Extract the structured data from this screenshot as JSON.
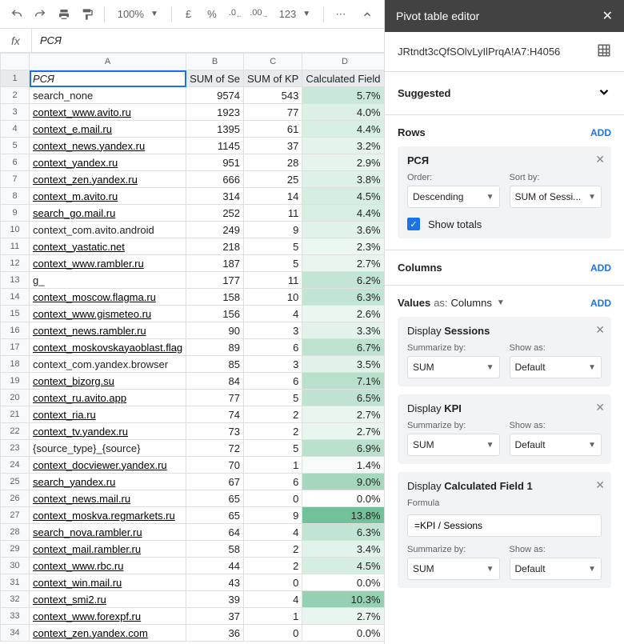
{
  "toolbar": {
    "zoom": "100%",
    "currency": "£",
    "percent": "%",
    "dec_dec": ".0",
    "dec_inc": ".00",
    "format": "123"
  },
  "formula": {
    "fx": "fx",
    "value": "РСЯ"
  },
  "columns": [
    "A",
    "B",
    "C",
    "D",
    ""
  ],
  "header_row": {
    "a": "РСЯ",
    "b": "SUM of Se",
    "c": "SUM of KP",
    "d": "Calculated Field"
  },
  "rows": [
    {
      "n": 2,
      "a": "search_none",
      "link": false,
      "b": 9574,
      "c": 543,
      "d": "5.7%",
      "bg": "#c9e8d9"
    },
    {
      "n": 3,
      "a": "context_www.avito.ru",
      "link": true,
      "b": 1923,
      "c": 77,
      "d": "4.0%",
      "bg": "#dcf0e6"
    },
    {
      "n": 4,
      "a": "context_e.mail.ru",
      "link": true,
      "b": 1395,
      "c": 61,
      "d": "4.4%",
      "bg": "#d7eee2"
    },
    {
      "n": 5,
      "a": "context_news.yandex.ru",
      "link": true,
      "b": 1145,
      "c": 37,
      "d": "3.2%",
      "bg": "#e4f3ec"
    },
    {
      "n": 6,
      "a": "context_yandex.ru",
      "link": true,
      "b": 951,
      "c": 28,
      "d": "2.9%",
      "bg": "#e7f4ee"
    },
    {
      "n": 7,
      "a": "context_zen.yandex.ru",
      "link": true,
      "b": 666,
      "c": 25,
      "d": "3.8%",
      "bg": "#def1e8"
    },
    {
      "n": 8,
      "a": "context_m.avito.ru",
      "link": true,
      "b": 314,
      "c": 14,
      "d": "4.5%",
      "bg": "#d6ede1"
    },
    {
      "n": 9,
      "a": "search_go.mail.ru",
      "link": true,
      "b": 252,
      "c": 11,
      "d": "4.4%",
      "bg": "#d7eee2"
    },
    {
      "n": 10,
      "a": "context_com.avito.android",
      "link": false,
      "b": 249,
      "c": 9,
      "d": "3.6%",
      "bg": "#e0f2ea"
    },
    {
      "n": 11,
      "a": "context_yastatic.net",
      "link": true,
      "b": 218,
      "c": 5,
      "d": "2.3%",
      "bg": "#edf7f2"
    },
    {
      "n": 12,
      "a": "context_www.rambler.ru",
      "link": true,
      "b": 187,
      "c": 5,
      "d": "2.7%",
      "bg": "#e9f5ef"
    },
    {
      "n": 13,
      "a": "g_",
      "link": false,
      "b": 177,
      "c": 11,
      "d": "6.2%",
      "bg": "#c3e5d4"
    },
    {
      "n": 14,
      "a": "context_moscow.flagma.ru",
      "link": true,
      "b": 158,
      "c": 10,
      "d": "6.3%",
      "bg": "#c2e4d3"
    },
    {
      "n": 15,
      "a": "context_www.gismeteo.ru",
      "link": true,
      "b": 156,
      "c": 4,
      "d": "2.6%",
      "bg": "#eaf6f0"
    },
    {
      "n": 16,
      "a": "context_news.rambler.ru",
      "link": true,
      "b": 90,
      "c": 3,
      "d": "3.3%",
      "bg": "#e3f3eb"
    },
    {
      "n": 17,
      "a": "context_moskovskayaoblast.flag",
      "link": true,
      "b": 89,
      "c": 6,
      "d": "6.7%",
      "bg": "#bde2cf"
    },
    {
      "n": 18,
      "a": "context_com.yandex.browser",
      "link": false,
      "b": 85,
      "c": 3,
      "d": "3.5%",
      "bg": "#e1f2ea"
    },
    {
      "n": 19,
      "a": "context_bizorg.su",
      "link": true,
      "b": 84,
      "c": 6,
      "d": "7.1%",
      "bg": "#b8e0cb"
    },
    {
      "n": 20,
      "a": "context_ru.avito.app",
      "link": true,
      "b": 77,
      "c": 5,
      "d": "6.5%",
      "bg": "#c0e3d1"
    },
    {
      "n": 21,
      "a": "context_ria.ru",
      "link": true,
      "b": 74,
      "c": 2,
      "d": "2.7%",
      "bg": "#e9f5ef"
    },
    {
      "n": 22,
      "a": "context_tv.yandex.ru",
      "link": true,
      "b": 73,
      "c": 2,
      "d": "2.7%",
      "bg": "#e9f5ef"
    },
    {
      "n": 23,
      "a": "{source_type}_{source}",
      "link": false,
      "b": 72,
      "c": 5,
      "d": "6.9%",
      "bg": "#bae1cd"
    },
    {
      "n": 24,
      "a": "context_docviewer.yandex.ru",
      "link": true,
      "b": 70,
      "c": 1,
      "d": "1.4%",
      "bg": "#f5fbf8"
    },
    {
      "n": 25,
      "a": "search_yandex.ru",
      "link": true,
      "b": 67,
      "c": 6,
      "d": "9.0%",
      "bg": "#a4d7bd"
    },
    {
      "n": 26,
      "a": "context_news.mail.ru",
      "link": true,
      "b": 65,
      "c": 0,
      "d": "0.0%",
      "bg": "#ffffff"
    },
    {
      "n": 27,
      "a": "context_moskva.regmarkets.ru",
      "link": true,
      "b": 65,
      "c": 9,
      "d": "13.8%",
      "bg": "#71c299"
    },
    {
      "n": 28,
      "a": "search_nova.rambler.ru",
      "link": true,
      "b": 64,
      "c": 4,
      "d": "6.3%",
      "bg": "#c2e4d3"
    },
    {
      "n": 29,
      "a": "context_mail.rambler.ru",
      "link": true,
      "b": 58,
      "c": 2,
      "d": "3.4%",
      "bg": "#e2f3eb"
    },
    {
      "n": 30,
      "a": "context_www.rbc.ru",
      "link": true,
      "b": 44,
      "c": 2,
      "d": "4.5%",
      "bg": "#d6ede1"
    },
    {
      "n": 31,
      "a": "context_win.mail.ru",
      "link": true,
      "b": 43,
      "c": 0,
      "d": "0.0%",
      "bg": "#ffffff"
    },
    {
      "n": 32,
      "a": "context_smi2.ru",
      "link": true,
      "b": 39,
      "c": 4,
      "d": "10.3%",
      "bg": "#96d0b2"
    },
    {
      "n": 33,
      "a": "context_www.forexpf.ru",
      "link": true,
      "b": 37,
      "c": 1,
      "d": "2.7%",
      "bg": "#e9f5ef"
    },
    {
      "n": 34,
      "a": "context_zen.yandex.com",
      "link": true,
      "b": 36,
      "c": 0,
      "d": "0.0%",
      "bg": "#ffffff"
    }
  ],
  "panel": {
    "title": "Pivot table editor",
    "range": "JRtndt3cQfSOlvLyIlPrqA!A7:H4056",
    "suggested": "Suggested",
    "rows_label": "Rows",
    "columns_label": "Columns",
    "values_label": "Values",
    "values_as": "as:",
    "values_as_val": "Columns",
    "add": "ADD",
    "row_card": {
      "title": "РСЯ",
      "order_lbl": "Order:",
      "order_val": "Descending",
      "sort_lbl": "Sort by:",
      "sort_val": "SUM of Sessi...",
      "show_totals": "Show totals"
    },
    "val_cards": [
      {
        "display": "Display",
        "name": "Sessions",
        "sum_lbl": "Summarize by:",
        "sum_val": "SUM",
        "show_lbl": "Show as:",
        "show_val": "Default"
      },
      {
        "display": "Display",
        "name": "KPI",
        "sum_lbl": "Summarize by:",
        "sum_val": "SUM",
        "show_lbl": "Show as:",
        "show_val": "Default"
      }
    ],
    "calc_card": {
      "display": "Display",
      "name": "Calculated Field 1",
      "formula_lbl": "Formula",
      "formula_val": "=KPI / Sessions",
      "sum_lbl": "Summarize by:",
      "sum_val": "SUM",
      "show_lbl": "Show as:",
      "show_val": "Default"
    }
  }
}
